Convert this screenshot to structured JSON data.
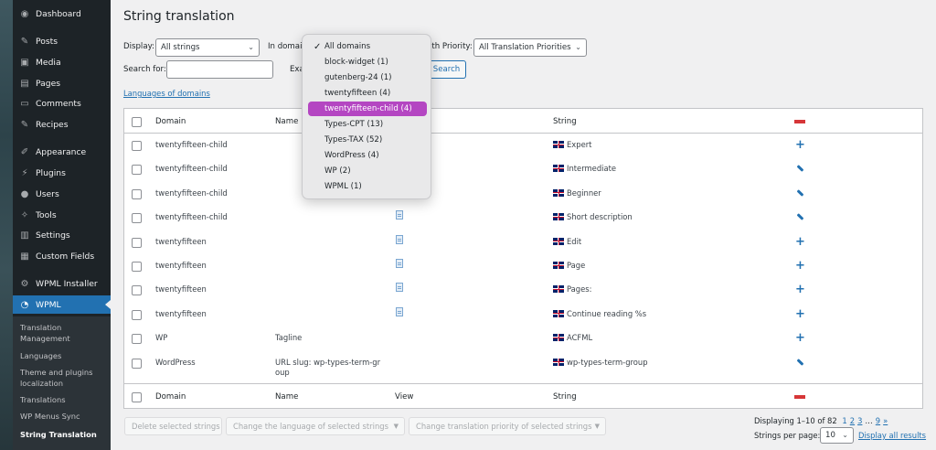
{
  "sidebar": {
    "items": [
      {
        "label": "Dashboard",
        "icon": "dashboard-icon"
      },
      {
        "label": "Posts",
        "icon": "pin-icon"
      },
      {
        "label": "Media",
        "icon": "media-icon"
      },
      {
        "label": "Pages",
        "icon": "pages-icon"
      },
      {
        "label": "Comments",
        "icon": "comment-icon"
      },
      {
        "label": "Recipes",
        "icon": "pin-icon"
      },
      {
        "label": "Appearance",
        "icon": "brush-icon"
      },
      {
        "label": "Plugins",
        "icon": "plug-icon"
      },
      {
        "label": "Users",
        "icon": "user-icon"
      },
      {
        "label": "Tools",
        "icon": "wrench-icon"
      },
      {
        "label": "Settings",
        "icon": "settings-icon"
      },
      {
        "label": "Custom Fields",
        "icon": "fields-icon"
      },
      {
        "label": "WPML Installer",
        "icon": "gear-icon"
      },
      {
        "label": "WPML",
        "icon": "wpml-icon"
      }
    ],
    "submenu": [
      "Translation Management",
      "Languages",
      "Theme and plugins localization",
      "Translations",
      "WP Menus Sync",
      "String Translation"
    ]
  },
  "page": {
    "title": "String translation"
  },
  "filters": {
    "display_label": "Display:",
    "display_value": "All strings",
    "domain_label": "In domai",
    "priority_label": "ith Priority:",
    "priority_value": "All Translation Priorities",
    "search_label": "Search for:",
    "search_value": "",
    "exact_label": "Exa",
    "search_button": "Search",
    "languages_link": "Languages of domains"
  },
  "domain_dropdown": {
    "options": [
      "All domains",
      "block-widget (1)",
      "gutenberg-24 (1)",
      "twentyfifteen (4)",
      "twentyfifteen-child (4)",
      "Types-CPT (13)",
      "Types-TAX (52)",
      "WordPress (4)",
      "WP (2)",
      "WPML (1)"
    ],
    "checked": "All domains",
    "highlighted": "twentyfifteen-child (4)",
    "accent": "#b446c2"
  },
  "table": {
    "headers": {
      "domain": "Domain",
      "name": "Name",
      "view": "View",
      "string": "String"
    },
    "rows": [
      {
        "domain": "twentyfifteen-child",
        "name": "",
        "view": false,
        "string": "Expert",
        "action": "plus"
      },
      {
        "domain": "twentyfifteen-child",
        "name": "",
        "view": false,
        "string": "Intermediate",
        "action": "pencil"
      },
      {
        "domain": "twentyfifteen-child",
        "name": "",
        "view": false,
        "string": "Beginner",
        "action": "pencil"
      },
      {
        "domain": "twentyfifteen-child",
        "name": "",
        "view": true,
        "string": "Short description",
        "action": "pencil"
      },
      {
        "domain": "twentyfifteen",
        "name": "",
        "view": true,
        "string": "Edit",
        "action": "plus"
      },
      {
        "domain": "twentyfifteen",
        "name": "",
        "view": true,
        "string": "Page",
        "action": "plus"
      },
      {
        "domain": "twentyfifteen",
        "name": "",
        "view": true,
        "string": "Pages:",
        "action": "plus"
      },
      {
        "domain": "twentyfifteen",
        "name": "",
        "view": true,
        "string": "Continue reading %s",
        "action": "plus"
      },
      {
        "domain": "WP",
        "name": "Tagline",
        "view": false,
        "string": "ACFML",
        "action": "plus"
      },
      {
        "domain": "WordPress",
        "name": "URL slug: wp-types-term-gr oup",
        "view": false,
        "string": "wp-types-term-group",
        "action": "pencil"
      }
    ]
  },
  "bulk": {
    "delete": "Delete selected strings",
    "change_language": "Change the language of selected strings",
    "change_priority": "Change translation priority of selected strings"
  },
  "pagination": {
    "displaying": "Displaying 1–10 of 82",
    "pages": [
      "1",
      "2",
      "3",
      "…",
      "9",
      "»"
    ],
    "per_page_label": "Strings per page:",
    "per_page_value": "10",
    "display_all": "Display all results"
  }
}
